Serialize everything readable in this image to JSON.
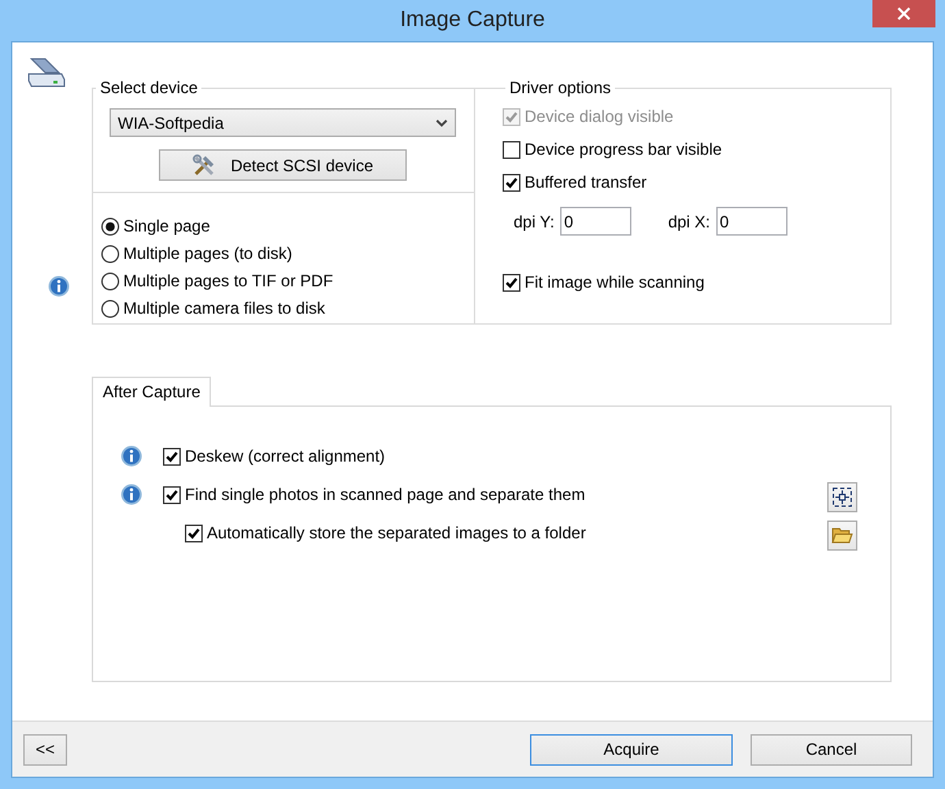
{
  "window": {
    "title": "Image Capture"
  },
  "select_device": {
    "label": "Select device",
    "device": "WIA-Softpedia",
    "detect_button": "Detect SCSI device"
  },
  "capture_modes": [
    {
      "label": "Single page",
      "selected": true
    },
    {
      "label": "Multiple pages (to disk)",
      "selected": false
    },
    {
      "label": "Multiple pages to TIF or PDF",
      "selected": false
    },
    {
      "label": "Multiple camera files to disk",
      "selected": false
    }
  ],
  "driver_options": {
    "label": "Driver options",
    "items": [
      {
        "kind": "checkbox",
        "label": "Device dialog visible",
        "checked": true,
        "disabled": true
      },
      {
        "kind": "checkbox",
        "label": "Device progress bar visible",
        "checked": false,
        "disabled": false
      },
      {
        "kind": "checkbox",
        "label": "Buffered transfer",
        "checked": true,
        "disabled": false
      },
      {
        "kind": "fields",
        "fields": [
          {
            "label": "dpi Y:",
            "value": "0"
          },
          {
            "label": "dpi X:",
            "value": "0"
          }
        ]
      },
      {
        "kind": "checkbox",
        "label": "Fit image while scanning",
        "checked": true,
        "disabled": false
      }
    ]
  },
  "tabs": [
    {
      "label": "After Capture",
      "selected": true
    }
  ],
  "after_capture": [
    {
      "label": "Deskew (correct alignment)",
      "checked": true,
      "info": true
    },
    {
      "label": "Find single photos in scanned page and separate them",
      "checked": true,
      "info": true,
      "children": [
        {
          "label": "Automatically store the separated images to a folder",
          "checked": true,
          "info": false
        }
      ]
    }
  ],
  "buttons": [
    {
      "kind": "back",
      "label": "<<",
      "focused": false
    },
    {
      "kind": "acquire",
      "label": "Acquire",
      "focused": true
    },
    {
      "kind": "cancel",
      "label": "Cancel",
      "focused": false
    }
  ]
}
